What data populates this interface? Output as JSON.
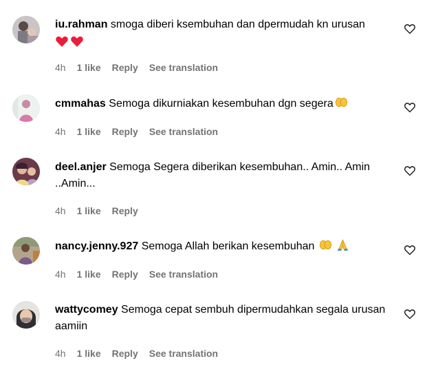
{
  "comments": [
    {
      "username": "iu.rahman",
      "text": "smoga diberi ksembuhan dan dpermudah kn urusan",
      "time": "4h",
      "likes": "1 like",
      "reply": "Reply",
      "translate": "See translation"
    },
    {
      "username": "cmmahas",
      "text": "Semoga dikurniakan kesembuhan dgn segera",
      "time": "4h",
      "likes": "1 like",
      "reply": "Reply",
      "translate": "See translation"
    },
    {
      "username": "deel.anjer",
      "text": "Semoga Segera diberikan kesembuhan.. Amin.. Amin ..Amin...",
      "time": "4h",
      "likes": "1 like",
      "reply": "Reply"
    },
    {
      "username": "nancy.jenny.927",
      "text": "Semoga Allah berikan kesembuhan",
      "time": "4h",
      "likes": "1 like",
      "reply": "Reply",
      "translate": "See translation"
    },
    {
      "username": "wattycomey",
      "text": "Semoga cepat sembuh dipermudahkan segala urusan aamiin",
      "time": "4h",
      "likes": "1 like",
      "reply": "Reply",
      "translate": "See translation"
    }
  ],
  "icons": {
    "like": "heart-outline-icon",
    "heart_emoji": "red-heart-emoji",
    "hands_emoji": "open-hands-emoji",
    "pray_emoji": "folded-hands-emoji"
  },
  "colors": {
    "meta": "#737373",
    "heart": "#ed1c3a",
    "emoji_yellow": "#f7c33b"
  }
}
